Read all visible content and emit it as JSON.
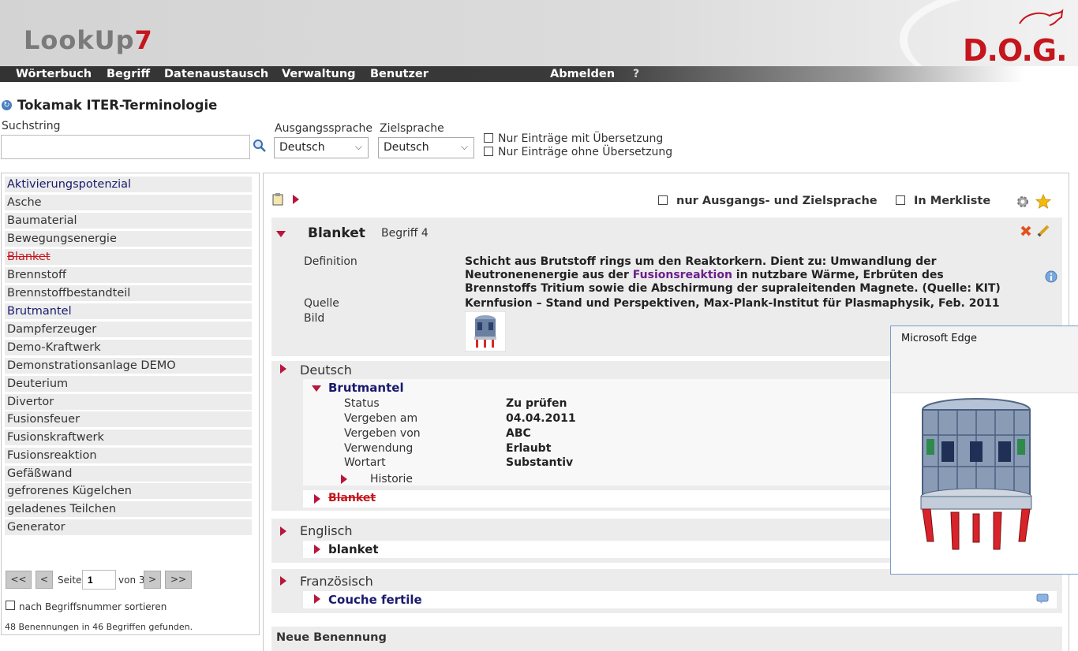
{
  "app": {
    "logo_grey": "LookUp",
    "logo_red": "7",
    "logo_suffix": "",
    "partner_logo": "D.O.G."
  },
  "nav": {
    "items": [
      "Wörterbuch",
      "Begriff",
      "Datenaustausch",
      "Verwaltung",
      "Benutzer"
    ],
    "logout": "Abmelden",
    "help": "?"
  },
  "page": {
    "title": "Tokamak ITER-Terminologie"
  },
  "search": {
    "label": "Suchstring",
    "value": "",
    "source_lang_label": "Ausgangssprache",
    "source_lang_value": "Deutsch",
    "target_lang_label": "Zielsprache",
    "target_lang_value": "Deutsch",
    "filter_with_translation": "Nur Einträge mit Übersetzung",
    "filter_without_translation": "Nur Einträge ohne Übersetzung"
  },
  "term_list": {
    "items": [
      "Aktivierungspotenzial",
      "Asche",
      "Baumaterial",
      "Bewegungsenergie",
      "Blanket",
      "Brennstoff",
      "Brennstoffbestandteil",
      "Brutmantel",
      "Dampferzeuger",
      "Demo-Kraftwerk",
      "Demonstrationsanlage DEMO",
      "Deuterium",
      "Divertor",
      "Fusionsfeuer",
      "Fusionskraftwerk",
      "Fusionsreaktion",
      "Gefäßwand",
      "gefrorenes Kügelchen",
      "geladenes Teilchen",
      "Generator"
    ],
    "pagination": {
      "first": "<<",
      "prev": "<",
      "page_label": "Seite",
      "page_value": "1",
      "of_label": "von",
      "total_pages": "3",
      "next": ">",
      "last": ">>"
    },
    "sort_label": "nach Begriffsnummer sortieren",
    "result_text": "48 Benennungen in 46 Begriffen gefunden."
  },
  "detail": {
    "option_source_target": "nur Ausgangs- und Zielsprache",
    "option_watchlist": "In Merkliste",
    "term_title": "Blanket",
    "concept_label": "Begriff 4",
    "definition_label": "Definition",
    "definition_part1": "Schicht aus Brutstoff rings um den Reaktorkern. Dient zu: Umwandlung der",
    "definition_part2a": "Neutronenenergie aus der ",
    "definition_link": "Fusionsreaktion",
    "definition_part2b": " in nutzbare Wärme, Erbrüten des",
    "definition_part3": "Brennstoffs Tritium sowie die Abschirmung der supraleitenden Magnete. (Quelle: KIT)",
    "source_label": "Quelle",
    "source_value": "Kernfusion – Stand und Perspektiven, Max-Plank-Institut für Plasmaphysik, Feb. 2011",
    "image_label": "Bild"
  },
  "languages": {
    "german": {
      "name": "Deutsch",
      "term1": "Brutmantel",
      "fields": {
        "status_label": "Status",
        "status_value": "Zu prüfen",
        "assigned_on_label": "Vergeben am",
        "assigned_on_value": "04.04.2011",
        "assigned_by_label": "Vergeben von",
        "assigned_by_value": "ABC",
        "usage_label": "Verwendung",
        "usage_value": "Erlaubt",
        "pos_label": "Wortart",
        "pos_value": "Substantiv"
      },
      "history_label": "Historie",
      "term2": "Blanket"
    },
    "english": {
      "name": "Englisch",
      "term": "blanket"
    },
    "french": {
      "name": "Französisch",
      "term": "Couche fertile"
    }
  },
  "new_term_label": "Neue Benennung",
  "popup": {
    "title": "Microsoft Edge"
  },
  "colors": {
    "accent_red": "#c4161c",
    "link_purple": "#6b1f8a",
    "term_navy": "#1a1a6e"
  }
}
